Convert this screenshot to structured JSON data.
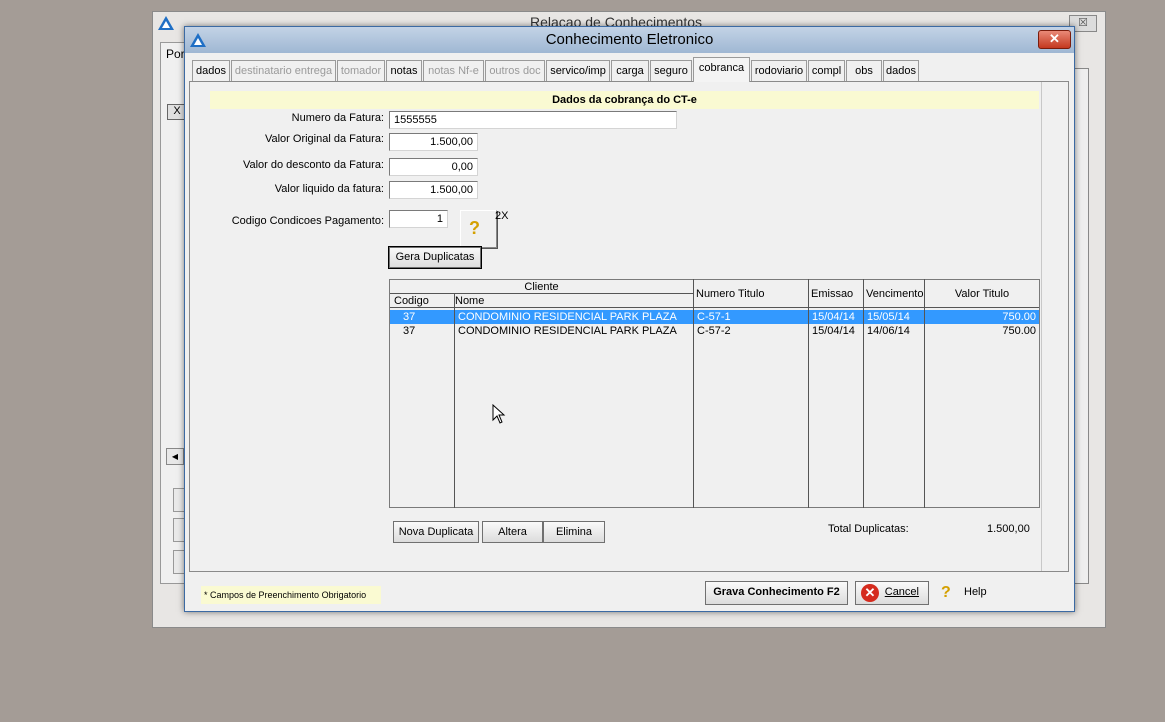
{
  "background_window": {
    "title": "Relacao de Conhecimentos",
    "close_label": "☒",
    "tab_label": "Por",
    "grid_header": "X",
    "scroll_left": "◀"
  },
  "dialog": {
    "title": "Conhecimento Eletronico",
    "close_label": "✕"
  },
  "tabs": [
    {
      "label": "dados",
      "state": "enabled"
    },
    {
      "label": "destinatario entrega",
      "state": "disabled"
    },
    {
      "label": "tomador",
      "state": "disabled"
    },
    {
      "label": "notas",
      "state": "enabled"
    },
    {
      "label": "notas Nf-e",
      "state": "disabled"
    },
    {
      "label": "outros doc",
      "state": "disabled"
    },
    {
      "label": "servico/imp",
      "state": "enabled"
    },
    {
      "label": "carga",
      "state": "enabled"
    },
    {
      "label": "seguro",
      "state": "enabled"
    },
    {
      "label": "cobranca",
      "state": "active"
    },
    {
      "label": "rodoviario",
      "state": "enabled"
    },
    {
      "label": "compl",
      "state": "enabled"
    },
    {
      "label": "obs",
      "state": "enabled"
    },
    {
      "label": "dados",
      "state": "enabled"
    }
  ],
  "cobranca": {
    "section_title": "Dados da cobrança do CT-e",
    "numero_fatura_label": "Numero da Fatura:",
    "numero_fatura_value": "1555555",
    "valor_original_label": "Valor Original da Fatura:",
    "valor_original_value": "1.500,00",
    "valor_desconto_label": "Valor do desconto da Fatura:",
    "valor_desconto_value": "0,00",
    "valor_liquido_label": "Valor liquido da fatura:",
    "valor_liquido_value": "1.500,00",
    "codigo_cond_label": "Codigo Condicoes Pagamento:",
    "codigo_cond_value": "1",
    "help_glyph": "?",
    "multiplier_label": "2X",
    "gera_button": "Gera Duplicatas"
  },
  "grid": {
    "group_header": "Cliente",
    "columns": [
      "Codigo",
      "Nome",
      "Numero Titulo",
      "Emissao",
      "Vencimento",
      "Valor Titulo"
    ],
    "rows": [
      {
        "codigo": "37",
        "nome": "CONDOMINIO RESIDENCIAL PARK PLAZA",
        "numero": "C-57-1",
        "emissao": "15/04/14",
        "vencimento": "15/05/14",
        "valor": "750.00",
        "selected": true
      },
      {
        "codigo": "37",
        "nome": "CONDOMINIO RESIDENCIAL PARK PLAZA",
        "numero": "C-57-2",
        "emissao": "15/04/14",
        "vencimento": "14/06/14",
        "valor": "750.00",
        "selected": false
      }
    ]
  },
  "actions": {
    "nova": "Nova Duplicata",
    "altera": "Altera",
    "elimina": "Elimina"
  },
  "totals": {
    "label": "Total Duplicatas:",
    "value": "1.500,00"
  },
  "footer": {
    "required_note": "* Campos de Preenchimento Obrigatorio",
    "grava_button": "Grava Conhecimento F2",
    "cancel_button": "Cancel",
    "help_label": "Help",
    "help_glyph": "?"
  },
  "colors": {
    "selection": "#3399ff",
    "highlight_yellow": "#fafad2",
    "desktop": "#a49c96"
  }
}
